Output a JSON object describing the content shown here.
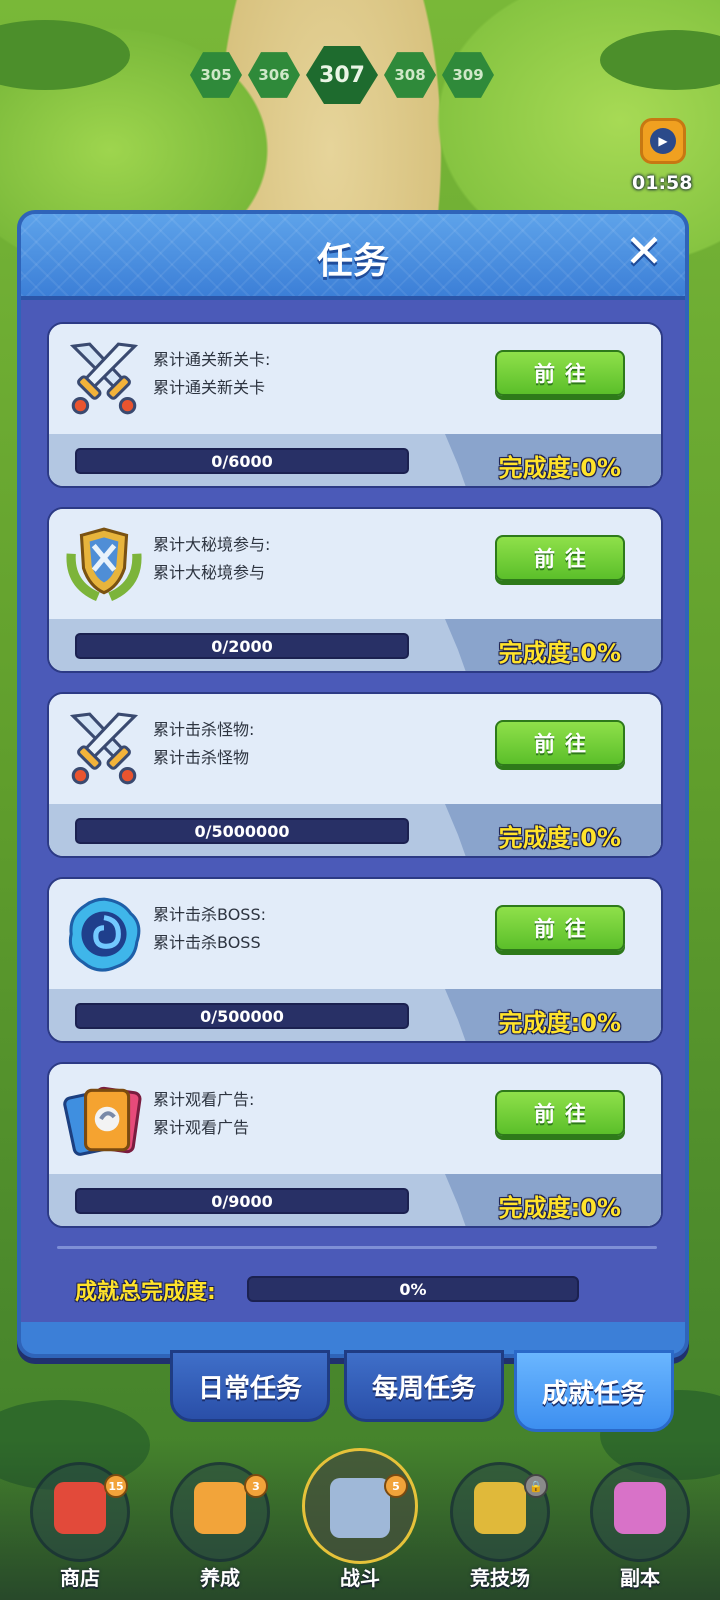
{
  "levels": [
    "305",
    "306",
    "307",
    "308",
    "309"
  ],
  "current_level": "307",
  "timer": "01:58",
  "modal": {
    "title": "任务",
    "close_icon": "close-icon"
  },
  "tasks": [
    {
      "line1": "累计通关新关卡:",
      "line2": "累计通关新关卡",
      "button": "前往",
      "progress": "0/6000",
      "progress_fraction": 0,
      "completion": "完成度:0%",
      "icon": "crossed-swords-icon"
    },
    {
      "line1": "累计大秘境参与:",
      "line2": "累计大秘境参与",
      "button": "前往",
      "progress": "0/2000",
      "progress_fraction": 0,
      "completion": "完成度:0%",
      "icon": "shield-laurel-icon"
    },
    {
      "line1": "累计击杀怪物:",
      "line2": "累计击杀怪物",
      "button": "前往",
      "progress": "0/5000000",
      "progress_fraction": 0,
      "completion": "完成度:0%",
      "icon": "crossed-swords-icon"
    },
    {
      "line1": "累计击杀BOSS:",
      "line2": "累计击杀BOSS",
      "button": "前往",
      "progress": "0/500000",
      "progress_fraction": 0,
      "completion": "完成度:0%",
      "icon": "vortex-icon"
    },
    {
      "line1": "累计观看广告:",
      "line2": "累计观看广告",
      "button": "前往",
      "progress": "0/9000",
      "progress_fraction": 0,
      "completion": "完成度:0%",
      "icon": "ad-cards-icon"
    }
  ],
  "total": {
    "label": "成就总完成度:",
    "value": "0%",
    "fraction": 0
  },
  "tabs": [
    {
      "label": "日常任务",
      "active": false
    },
    {
      "label": "每周任务",
      "active": false
    },
    {
      "label": "成就任务",
      "active": true
    }
  ],
  "nav": [
    {
      "label": "商店",
      "badge": "15",
      "icon": "gift-shop-icon",
      "color": "#e24a3a"
    },
    {
      "label": "养成",
      "badge": "3",
      "icon": "card-upgrade-icon",
      "color": "#f2a43a"
    },
    {
      "label": "战斗",
      "badge": "5",
      "icon": "crossed-swords-icon",
      "color": "#9fb8d8",
      "active": true
    },
    {
      "label": "竞技场",
      "badge": "",
      "icon": "arena-shield-icon",
      "color": "#e0b93a",
      "locked": true
    },
    {
      "label": "副本",
      "badge": "",
      "icon": "dungeon-jar-icon",
      "color": "#d872c8"
    }
  ]
}
